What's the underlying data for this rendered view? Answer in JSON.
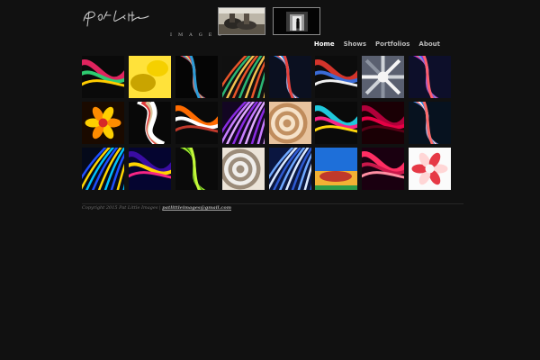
{
  "logo": {
    "script": "Pat Little",
    "subtitle": "IMAGES",
    "icon": "signature-logo"
  },
  "header_images": [
    {
      "name": "header-photo-shoes",
      "icon": "photo-thumbnail"
    },
    {
      "name": "header-photo-tunnel",
      "icon": "photo-thumbnail"
    }
  ],
  "nav": {
    "items": [
      {
        "label": "Home",
        "active": true
      },
      {
        "label": "Shows",
        "active": false
      },
      {
        "label": "Portfolios",
        "active": false
      },
      {
        "label": "About",
        "active": false
      }
    ]
  },
  "gallery": {
    "tiles": [
      {
        "style": "ribbon",
        "colors": [
          "#0a0a0a",
          "#e0245e",
          "#2ecc71",
          "#ffcc00"
        ]
      },
      {
        "style": "blob",
        "colors": [
          "#e6c200",
          "#ffe23a",
          "#c9a400",
          "#f5d000"
        ]
      },
      {
        "style": "helix",
        "colors": [
          "#050505",
          "#e63946",
          "#2b9cd8",
          "#ffd166"
        ]
      },
      {
        "style": "stripes",
        "colors": [
          "#101010",
          "#e8552a",
          "#2bb673",
          "#f2c14e"
        ]
      },
      {
        "style": "helix",
        "colors": [
          "#0b1020",
          "#1c8bf0",
          "#e8423c",
          "#ffffff"
        ]
      },
      {
        "style": "ribbon",
        "colors": [
          "#0c0c0c",
          "#d3342b",
          "#3a6bd6",
          "#f0f0f0"
        ]
      },
      {
        "style": "crystal",
        "colors": [
          "#5a6070",
          "#cfd3d8",
          "#f4f4f4",
          "#8c93a0"
        ]
      },
      {
        "style": "helix",
        "colors": [
          "#0d0f2a",
          "#8e2de2",
          "#ff5f6d",
          "#3bb2ff"
        ]
      },
      {
        "style": "flower",
        "colors": [
          "#1a0a00",
          "#ff8c00",
          "#ffcf00",
          "#d62828"
        ]
      },
      {
        "style": "spiral",
        "colors": [
          "#080808",
          "#ffffff",
          "#e03a3a",
          "#d9c49a"
        ]
      },
      {
        "style": "ribbon",
        "colors": [
          "#0a0a0a",
          "#ff6b00",
          "#ffffff",
          "#c0392b"
        ]
      },
      {
        "style": "stripes",
        "colors": [
          "#130622",
          "#8a2be2",
          "#c77dff",
          "#e0aaff"
        ]
      },
      {
        "style": "shell",
        "colors": [
          "#3a2412",
          "#e8c39e",
          "#b98250",
          "#fff1dc"
        ]
      },
      {
        "style": "ribbon",
        "colors": [
          "#0a0a0a",
          "#1fc8db",
          "#f72585",
          "#ffd60a"
        ]
      },
      {
        "style": "ribbon",
        "colors": [
          "#1a0005",
          "#b1003a",
          "#e60045",
          "#5a0016"
        ]
      },
      {
        "style": "helix",
        "colors": [
          "#07121f",
          "#2e86de",
          "#ff6b6b",
          "#ffffff"
        ]
      },
      {
        "style": "stripes",
        "colors": [
          "#050a1a",
          "#1f4fff",
          "#ffd600",
          "#00c2ff"
        ]
      },
      {
        "style": "ribbon",
        "colors": [
          "#050530",
          "#3a0ca3",
          "#ffd400",
          "#f72585"
        ]
      },
      {
        "style": "helix",
        "colors": [
          "#0a0a0a",
          "#7dd321",
          "#c3f73a",
          "#2d6a0f"
        ]
      },
      {
        "style": "shell",
        "colors": [
          "#1a1a1a",
          "#ece4d8",
          "#8d7b68",
          "#ffffff"
        ]
      },
      {
        "style": "stripes",
        "colors": [
          "#0a1640",
          "#6fa8ff",
          "#dbe9ff",
          "#2f5bd3"
        ]
      },
      {
        "style": "landscape",
        "colors": [
          "#1e6fd9",
          "#f2b134",
          "#c0392b",
          "#2d9b48"
        ]
      },
      {
        "style": "ribbon",
        "colors": [
          "#1a0010",
          "#ff2e63",
          "#c9184a",
          "#ff8fa3"
        ]
      },
      {
        "style": "flower",
        "colors": [
          "#fbfbfb",
          "#ffd6d6",
          "#e63946",
          "#f6f6f6"
        ]
      }
    ]
  },
  "footer": {
    "copyright": "Copyright 2015 Pat Little Images |",
    "email": "patlittleimages@gmail.com"
  }
}
